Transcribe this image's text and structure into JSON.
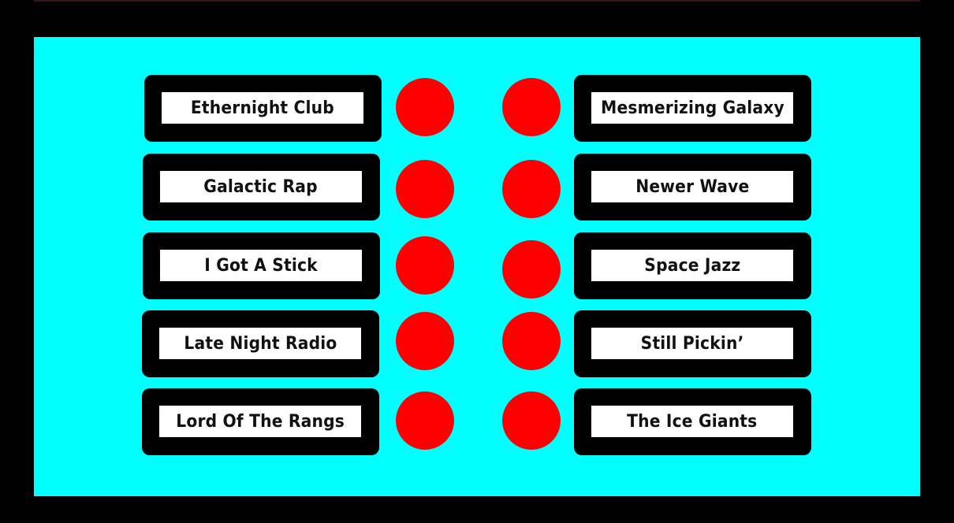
{
  "colors": {
    "background": "#000000",
    "board": "#00ffff",
    "frame": "#000000",
    "label_background": "#ffffff",
    "indicator": "#ff0000"
  },
  "left_stations": [
    {
      "label": "Ethernight Club"
    },
    {
      "label": "Galactic Rap"
    },
    {
      "label": "I Got A Stick"
    },
    {
      "label": "Late Night Radio"
    },
    {
      "label": "Lord Of The Rangs"
    }
  ],
  "right_stations": [
    {
      "label": "Mesmerizing Galaxy"
    },
    {
      "label": "Newer Wave"
    },
    {
      "label": "Space Jazz"
    },
    {
      "label": "Still Pickin’"
    },
    {
      "label": "The Ice Giants"
    }
  ],
  "indicator_icon": "red-circle"
}
